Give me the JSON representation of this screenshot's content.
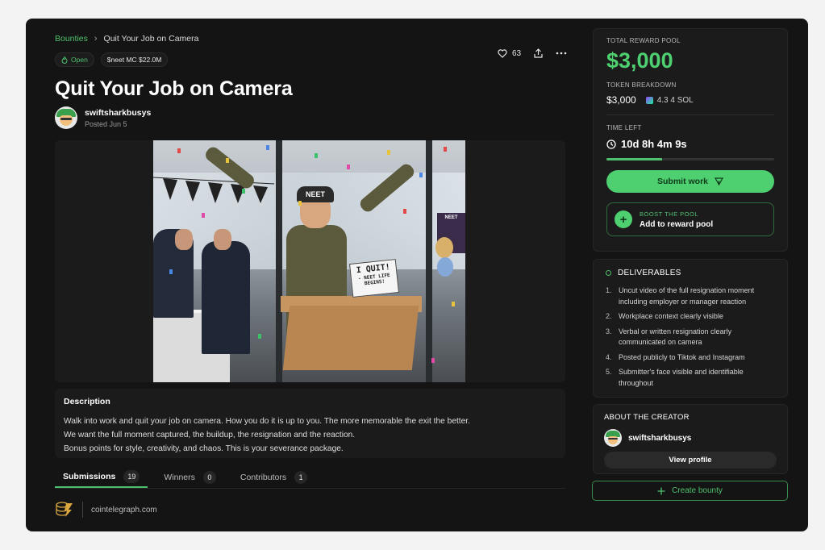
{
  "breadcrumb": {
    "parent": "Bounties",
    "current": "Quit Your Job on Camera"
  },
  "badges": {
    "status": "Open",
    "market_cap": "$neet MC $22.0M"
  },
  "actions": {
    "likes": "63"
  },
  "title": "Quit Your Job on Camera",
  "creator": {
    "name": "swiftsharkbusys",
    "posted": "Posted Jun 5"
  },
  "hero": {
    "sign_line1": "I QUIT!",
    "sign_line2": "- NEET LIFE BEGINS!",
    "beanie_text": "NEET",
    "poster_text": "NEET"
  },
  "description": {
    "heading": "Description",
    "lines": [
      "Walk into work and quit your job on camera. How you do it is up to you. The more memorable the exit the better.",
      "We want the full moment captured, the buildup, the resignation and the reaction.",
      "Bonus points for style, creativity, and chaos. This is your severance package."
    ]
  },
  "tabs": [
    {
      "label": "Submissions",
      "count": "19"
    },
    {
      "label": "Winners",
      "count": "0"
    },
    {
      "label": "Contributors",
      "count": "1"
    }
  ],
  "footer": {
    "source": "cointelegraph.com"
  },
  "reward": {
    "pool_label": "TOTAL REWARD POOL",
    "amount": "$3,000",
    "breakdown_label": "TOKEN BREAKDOWN",
    "usd": "$3,000",
    "sol": "4.3 4 SOL",
    "time_label": "TIME LEFT",
    "time_left": "10d 8h 4m 9s",
    "progress_fraction": 0.33,
    "submit_label": "Submit work",
    "boost_title": "BOOST THE POOL",
    "boost_action": "Add to reward pool"
  },
  "deliverables": {
    "heading": "DELIVERABLES",
    "items": [
      "Uncut video of the full resignation moment including employer or manager reaction",
      "Workplace context clearly visible",
      "Verbal or written resignation clearly communicated on camera",
      "Posted publicly to Tiktok and Instagram",
      "Submitter's face visible and identifiable throughout"
    ]
  },
  "about": {
    "heading": "ABOUT THE CREATOR",
    "name": "swiftsharkbusys",
    "view_label": "View profile"
  },
  "create_label": "Create bounty",
  "colors": {
    "accent": "#4fc06d",
    "amount": "#4fd070",
    "background": "#141414",
    "panel": "#1b1b1b"
  }
}
